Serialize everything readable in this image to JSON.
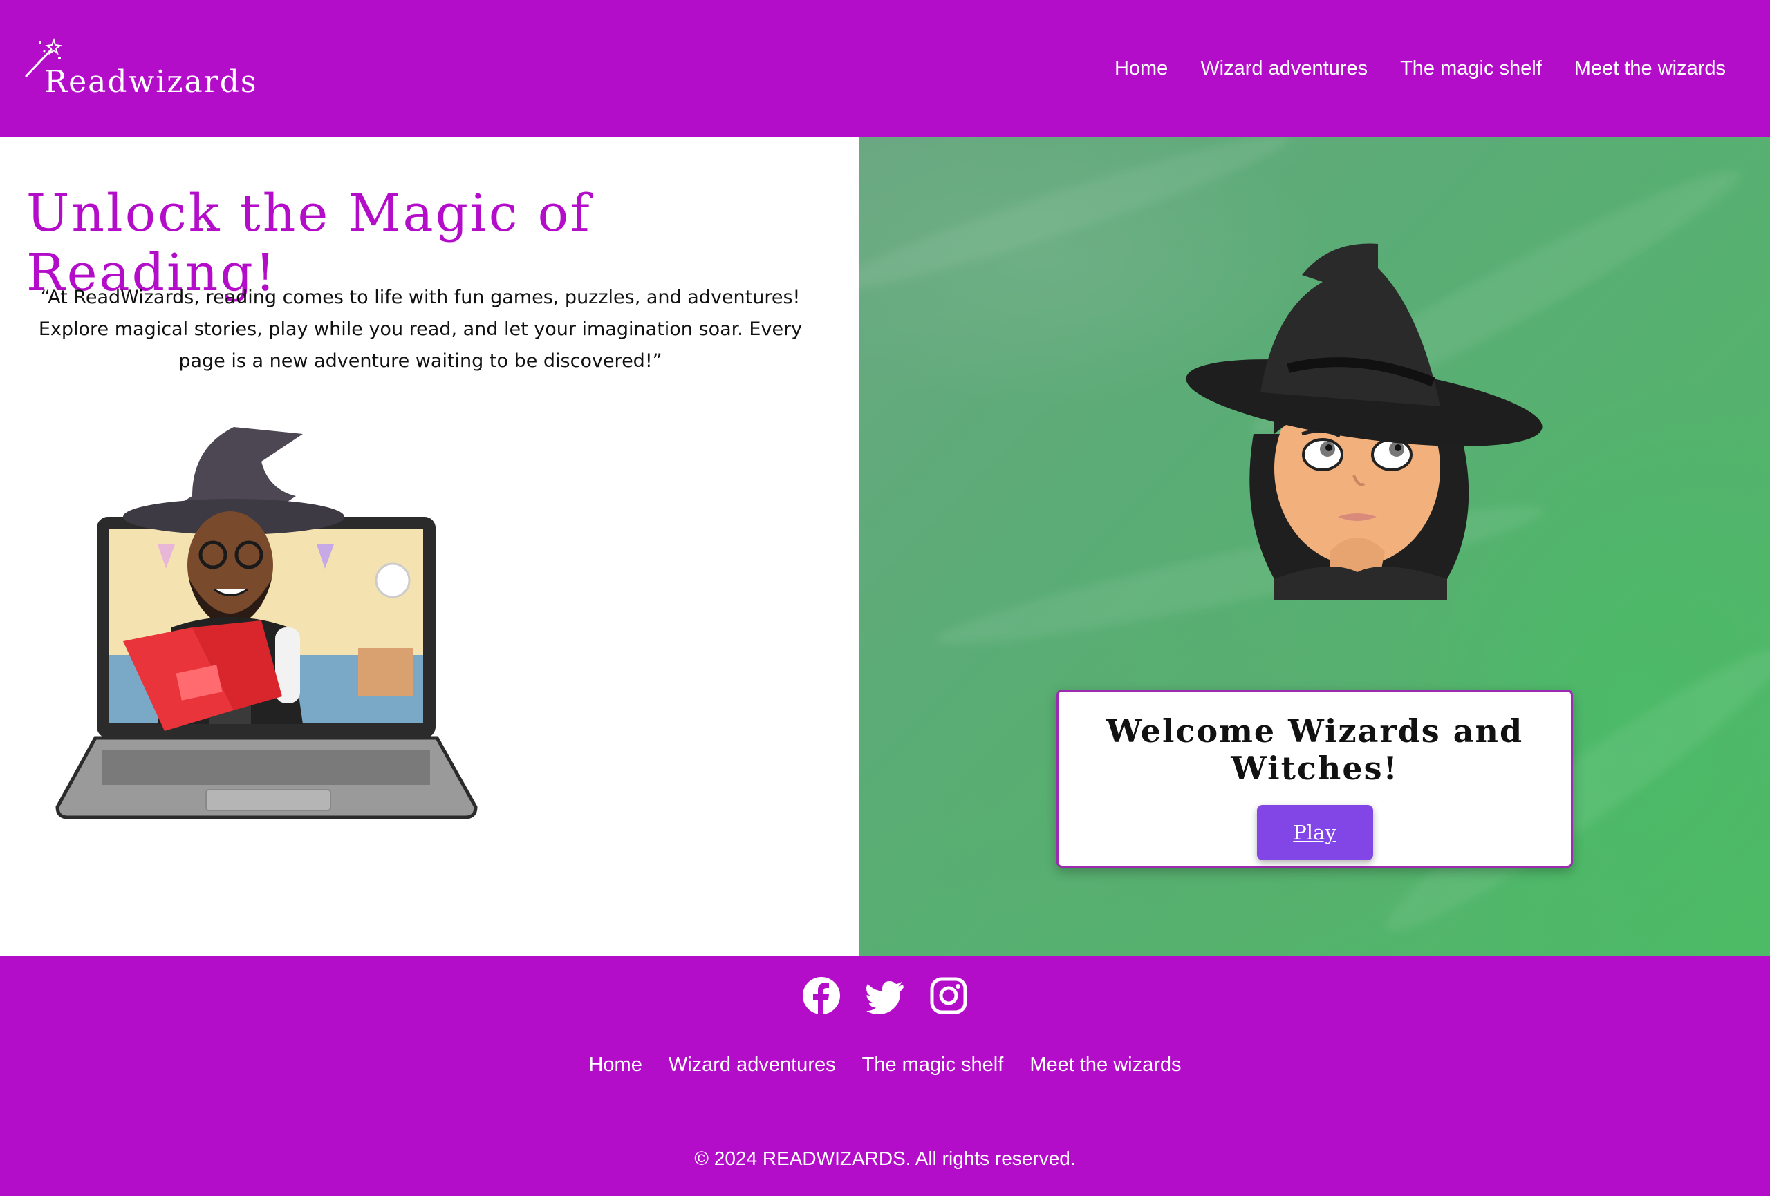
{
  "header": {
    "logo_text": "Readwizards",
    "nav": [
      "Home",
      "Wizard adventures",
      "The magic shelf",
      "Meet the wizards"
    ]
  },
  "hero": {
    "title": "Unlock the Magic of Reading!",
    "quote": "“At ReadWizards, reading comes to life with fun games, puzzles, and adventures! Explore magical stories, play while you read, and let your imagination soar. Every page is a new adventure waiting to be discovered!”"
  },
  "welcome_card": {
    "title": "Welcome Wizards and Witches!",
    "play_label": "Play"
  },
  "footer": {
    "social_icons": [
      "facebook-icon",
      "twitter-icon",
      "instagram-icon"
    ],
    "nav": [
      "Home",
      "Wizard adventures",
      "The magic shelf",
      "Meet the wizards"
    ],
    "copyright": "© 2024 READWIZARDS. All rights reserved."
  },
  "colors": {
    "brand_purple": "#b40dc9",
    "button_purple": "#8245e6",
    "background_green": "#55b26e"
  }
}
